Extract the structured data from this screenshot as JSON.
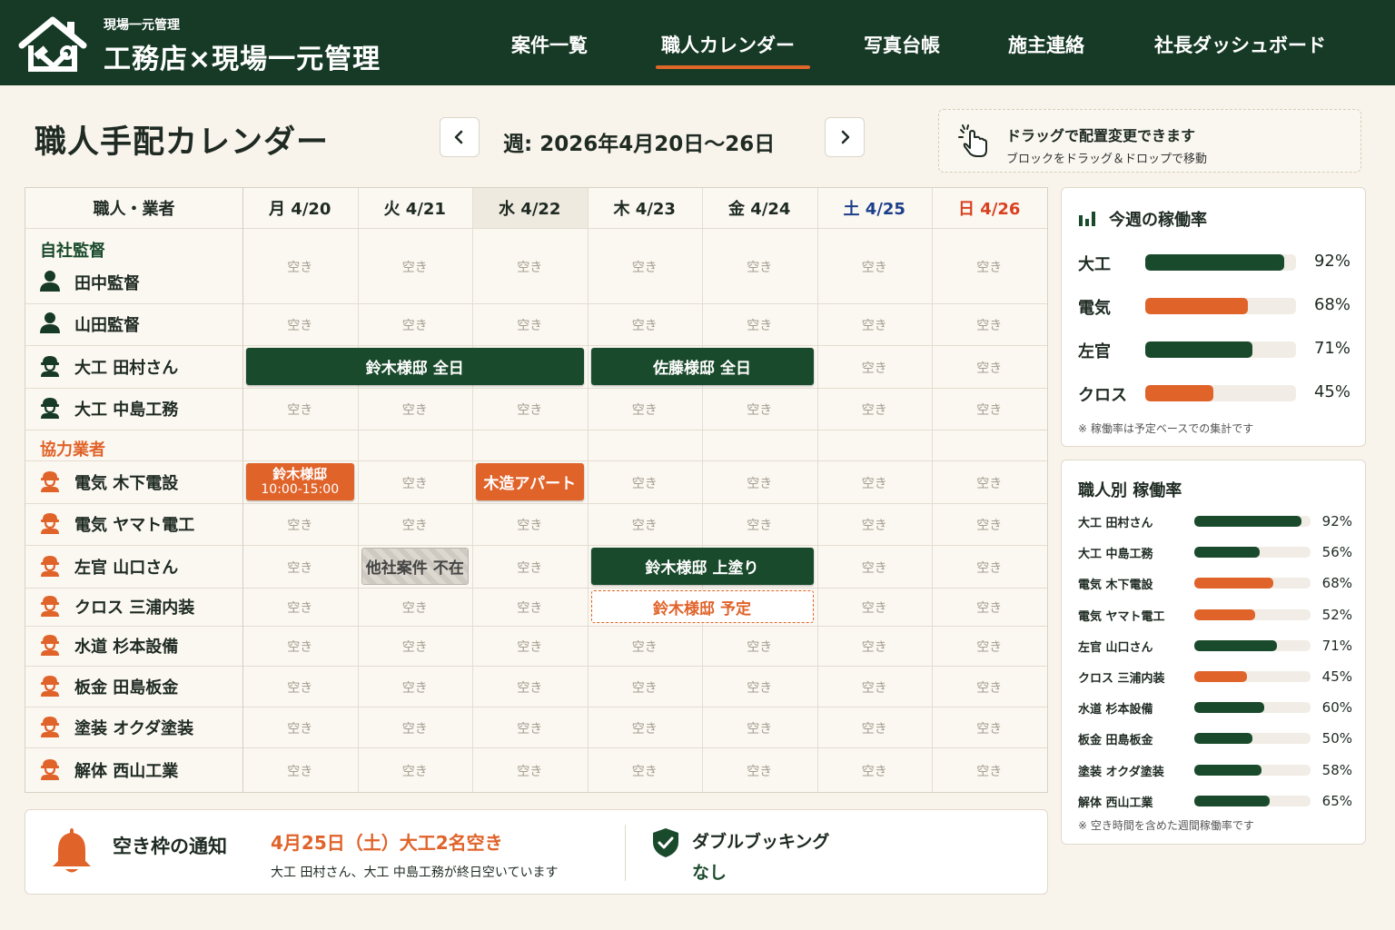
{
  "header": {
    "brand_small": "現場一元管理",
    "brand_title": "工務店×現場一元管理",
    "nav": [
      {
        "label": "案件一覧",
        "active": false
      },
      {
        "label": "職人カレンダー",
        "active": true
      },
      {
        "label": "写真台帳",
        "active": false
      },
      {
        "label": "施主連絡",
        "active": false
      },
      {
        "label": "社長ダッシュボード",
        "active": false
      }
    ]
  },
  "page": {
    "title": "職人手配カレンダー",
    "week_label": "週: 2026年4月20日〜26日",
    "drag_hint": {
      "title": "ドラッグで配置変更できます",
      "sub": "ブロックをドラッグ＆ドロップで移動"
    }
  },
  "calendar": {
    "name_header": "職人・業者",
    "days": [
      {
        "label": "月 4/20",
        "color": "#1e2a22"
      },
      {
        "label": "火 4/21",
        "color": "#1e2a22"
      },
      {
        "label": "水 4/22",
        "color": "#1e2a22"
      },
      {
        "label": "木 4/23",
        "color": "#1e2a22"
      },
      {
        "label": "金 4/24",
        "color": "#1e2a22"
      },
      {
        "label": "土 4/25",
        "color": "#1c3f8a"
      },
      {
        "label": "日 4/26",
        "color": "#d9401f"
      }
    ],
    "empty_label": "空き",
    "group_own": "自社監督",
    "group_partner": "協力業者",
    "people": [
      {
        "name": "田中監督",
        "icon": "person-icon"
      },
      {
        "name": "山田監督",
        "icon": "person-icon"
      },
      {
        "name": "大工 田村さん",
        "icon": "worker-green-icon"
      },
      {
        "name": "大工 中島工務",
        "icon": "worker-green-icon"
      },
      {
        "name": "電気 木下電設",
        "icon": "worker-orange-icon"
      },
      {
        "name": "電気 ヤマト電工",
        "icon": "worker-orange-icon"
      },
      {
        "name": "左官 山口さん",
        "icon": "worker-orange-icon"
      },
      {
        "name": "クロス 三浦内装",
        "icon": "worker-orange-icon"
      },
      {
        "name": "水道 杉本設備",
        "icon": "worker-orange-icon"
      },
      {
        "name": "板金 田島板金",
        "icon": "worker-orange-icon"
      },
      {
        "name": "塗装 オクダ塗装",
        "icon": "worker-orange-icon"
      },
      {
        "name": "解体 西山工業",
        "icon": "worker-orange-icon"
      }
    ],
    "blocks": [
      {
        "row": 2,
        "start": 0,
        "span": 3,
        "label": "鈴木様邸 全日",
        "sub": "",
        "style": "green"
      },
      {
        "row": 2,
        "start": 3,
        "span": 2,
        "label": "佐藤様邸 全日",
        "sub": "",
        "style": "green"
      },
      {
        "row": 4,
        "start": 0,
        "span": 1,
        "label": "鈴木様邸",
        "sub": "10:00-15:00",
        "style": "orange"
      },
      {
        "row": 4,
        "start": 2,
        "span": 1,
        "label": "木造アパート",
        "sub": "",
        "style": "orange"
      },
      {
        "row": 6,
        "start": 1,
        "span": 1,
        "label": "他社案件 不在",
        "sub": "",
        "style": "gray"
      },
      {
        "row": 6,
        "start": 3,
        "span": 2,
        "label": "鈴木様邸 上塗り",
        "sub": "",
        "style": "green"
      },
      {
        "row": 7,
        "start": 3,
        "span": 2,
        "label": "鈴木様邸 予定",
        "sub": "",
        "style": "dashed"
      }
    ]
  },
  "utilization": {
    "title": "今週の稼働率",
    "items": [
      {
        "label": "大工",
        "pct": 92,
        "value": "92%",
        "color": "#1a4a2c"
      },
      {
        "label": "電気",
        "pct": 68,
        "value": "68%",
        "color": "#e0632a"
      },
      {
        "label": "左官",
        "pct": 71,
        "value": "71%",
        "color": "#1a4a2c"
      },
      {
        "label": "クロス",
        "pct": 45,
        "value": "45%",
        "color": "#e0632a"
      }
    ],
    "note": "※ 稼働率は予定ベースでの集計です"
  },
  "worker_util": {
    "title": "職人別 稼働率",
    "items": [
      {
        "label": "大工 田村さん",
        "pct": 92,
        "value": "92%",
        "color": "#1a4a2c"
      },
      {
        "label": "大工 中島工務",
        "pct": 56,
        "value": "56%",
        "color": "#1a4a2c"
      },
      {
        "label": "電気 木下電設",
        "pct": 68,
        "value": "68%",
        "color": "#e0632a"
      },
      {
        "label": "電気 ヤマト電工",
        "pct": 52,
        "value": "52%",
        "color": "#e0632a"
      },
      {
        "label": "左官 山口さん",
        "pct": 71,
        "value": "71%",
        "color": "#1a4a2c"
      },
      {
        "label": "クロス 三浦内装",
        "pct": 45,
        "value": "45%",
        "color": "#e0632a"
      },
      {
        "label": "水道 杉本設備",
        "pct": 60,
        "value": "60%",
        "color": "#1a4a2c"
      },
      {
        "label": "板金 田島板金",
        "pct": 50,
        "value": "50%",
        "color": "#1a4a2c"
      },
      {
        "label": "塗装 オクダ塗装",
        "pct": 58,
        "value": "58%",
        "color": "#1a4a2c"
      },
      {
        "label": "解体 西山工業",
        "pct": 65,
        "value": "65%",
        "color": "#1a4a2c"
      }
    ],
    "note": "※ 空き時間を含めた週間稼働率です"
  },
  "notice": {
    "label": "空き枠の通知",
    "headline": "4月25日（土）大工2名空き",
    "detail": "大工 田村さん、大工 中島工務が終日空いています",
    "double_booking_label": "ダブルブッキング",
    "double_booking_value": "なし"
  },
  "colors": {
    "brand": "#163a26",
    "accent": "#e0672a",
    "green": "#1a4a2c",
    "orange": "#e0632a"
  }
}
